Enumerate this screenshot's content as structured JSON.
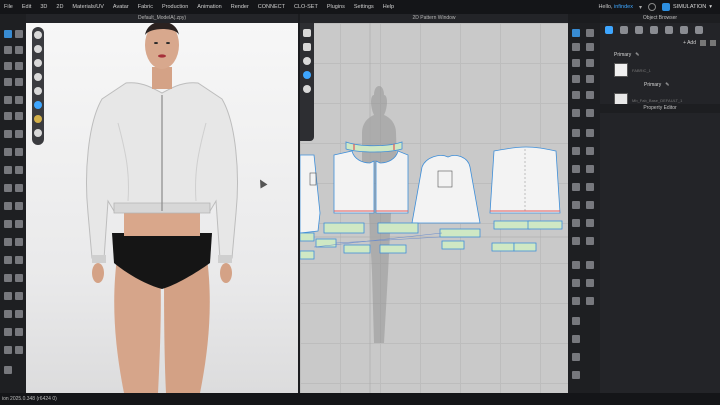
{
  "menubar": {
    "items": [
      "File",
      "Edit",
      "3D",
      "2D",
      "Materials/UV",
      "Avatar",
      "Fabric",
      "Production",
      "Animation",
      "Render",
      "CONNECT",
      "CLO-SET",
      "Plugins",
      "Settings",
      "Help"
    ],
    "greeting": "Hello,",
    "user": "infindex",
    "simulation_label": "SIMULATION"
  },
  "viewport3d": {
    "title": "Default_ModelA(.zpy)"
  },
  "viewport2d": {
    "title": "2D Pattern Window"
  },
  "object_browser": {
    "title": "Object Browser",
    "add_label": "+ Add",
    "group_label": "Primary",
    "fabric_label": "Primary",
    "fabric_name": "FABRIC_1",
    "trim_name": "Mb_Fab_Base_DEFAULT_1"
  },
  "property_editor": {
    "title": "Property Editor"
  },
  "status": {
    "text": "ion 2025.0.348 (r6424 0)"
  },
  "colors": {
    "accent": "#3ea6ff",
    "pattern_outline": "#3f8fd9",
    "seam": "#e05a5a",
    "trim_fill": "#cfe8c4",
    "canvas": "#c9c9c9"
  }
}
